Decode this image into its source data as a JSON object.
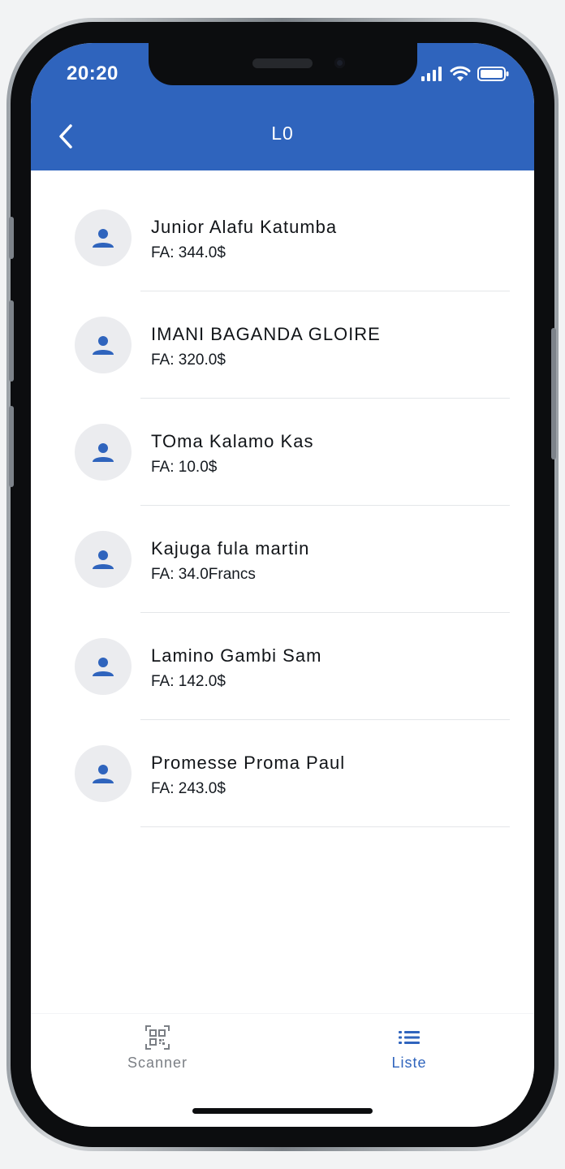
{
  "status_bar": {
    "time": "20:20",
    "icons": [
      "signal-icon",
      "wifi-icon",
      "battery-icon"
    ]
  },
  "header": {
    "title": "L0",
    "back_icon": "chevron-left-icon"
  },
  "list": {
    "items": [
      {
        "name": "Junior Alafu Katumba",
        "amount": "FA: 344.0$"
      },
      {
        "name": "IMANI BAGANDA GLOIRE",
        "amount": "FA: 320.0$"
      },
      {
        "name": "TOma Kalamo Kas",
        "amount": "FA: 10.0$"
      },
      {
        "name": "Kajuga fula martin",
        "amount": "FA: 34.0Francs"
      },
      {
        "name": "Lamino Gambi Sam",
        "amount": "FA: 142.0$"
      },
      {
        "name": "Promesse Proma Paul",
        "amount": "FA: 243.0$"
      }
    ]
  },
  "tabbar": {
    "scanner_label": "Scanner",
    "liste_label": "Liste",
    "active": "Liste"
  },
  "colors": {
    "primary": "#2f64bd",
    "avatar_bg": "#ebecef",
    "inactive_tab": "#7b7f85"
  }
}
